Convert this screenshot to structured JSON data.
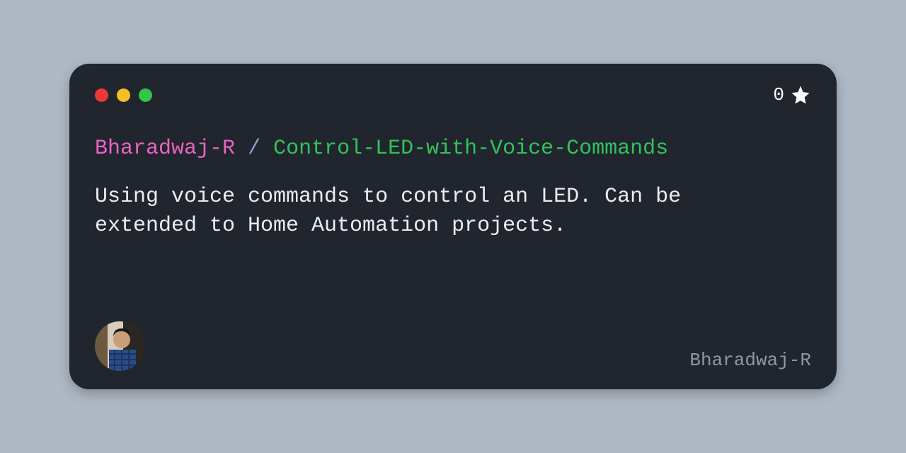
{
  "owner": "Bharadwaj-R",
  "separator": "/",
  "repo": "Control-LED-with-Voice-Commands",
  "description": "Using voice commands to control an LED. Can be extended to Home Automation projects.",
  "stars": "0",
  "footer_username": "Bharadwaj-R"
}
